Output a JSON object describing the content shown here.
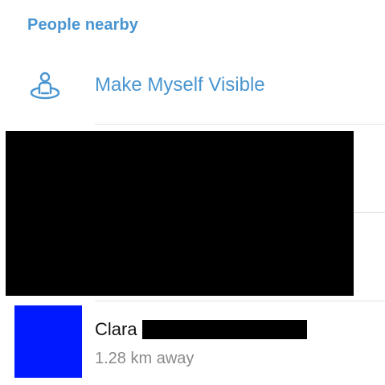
{
  "section": {
    "title": "People nearby"
  },
  "visibility_action": {
    "label": "Make Myself Visible",
    "icon": "person-location-icon"
  },
  "people": [
    {
      "name": "Clara",
      "distance": "1.28 km away",
      "avatar_color": "#0019ff"
    }
  ],
  "colors": {
    "accent": "#4a95d0",
    "secondary_text": "#8a8a8a",
    "divider": "#e3e3e3"
  }
}
